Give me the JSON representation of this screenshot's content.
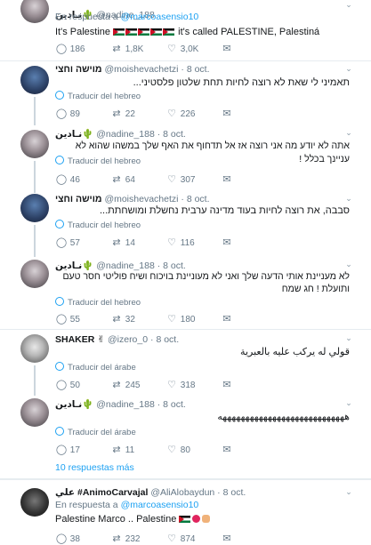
{
  "tweets": [
    {
      "name_display": "نـادين🌵",
      "handle": "@nadine_188",
      "date": "",
      "avatar": "female-photo",
      "reply_prefix": "En respuesta a",
      "reply_to": "@marcoasensio10",
      "text_before": "It's Palestine",
      "text_after": "it's called PALESTINE, Palestiná",
      "translate": "",
      "reply_count": "",
      "retweets": "1,8K",
      "likes": "3,0K",
      "replies": "186"
    },
    {
      "name_display": "מוישה וחצי",
      "handle": "@moishevachetzi",
      "date": "8 oct.",
      "text": "תאמיני לי שאת לא רוצה לחיות תחת שלטון פלסטיני...",
      "translate": "Traducir del hebreo",
      "replies": "89",
      "retweets": "22",
      "likes": "226"
    },
    {
      "name_display": "نـادين🌵",
      "handle": "@nadine_188",
      "date": "8 oct.",
      "text": "אתה לא יודע מה אני רוצה אז אל תדחוף את האף שלך במשהו שהוא לא עניינך בכלל !",
      "translate": "Traducir del hebreo",
      "replies": "46",
      "retweets": "64",
      "likes": "307"
    },
    {
      "name_display": "מוישה וחצי",
      "handle": "@moishevachetzi",
      "date": "8 oct.",
      "text": "סבבה, את רוצה לחיות בעוד מדינה ערבית נחשלת ומושחתת...",
      "translate": "Traducir del hebreo",
      "replies": "57",
      "retweets": "14",
      "likes": "116"
    },
    {
      "name_display": "نـادين🌵",
      "handle": "@nadine_188",
      "date": "8 oct.",
      "text": "לא מעניינת אותי הדעה שלך ואני לא מעוניינת בויכוח ושיח פוליטי חסר טעם ותועלת ! חג שמח",
      "translate": "Traducir del hebreo",
      "replies": "55",
      "retweets": "32",
      "likes": "180"
    },
    {
      "name_display": "SHAKER ✌",
      "handle": "@izero_0",
      "date": "8 oct.",
      "text": "قولي له يركب عليه بالعبرية",
      "translate": "Traducir del árabe",
      "replies": "50",
      "retweets": "245",
      "likes": "318"
    },
    {
      "name_display": "نـادين🌵",
      "handle": "@nadine_188",
      "date": "8 oct.",
      "text": "ههههههههههههههههههههههههههههه",
      "translate": "Traducir del árabe",
      "replies": "17",
      "retweets": "11",
      "likes": "80"
    },
    {
      "name_display": "علي #AnimoCarvajal",
      "handle": "@AliAlobaydun",
      "date": "8 oct.",
      "reply_prefix": "En respuesta a",
      "reply_to": "@marcoasensio10",
      "text": "Palestine Marco .. Palestine",
      "replies": "38",
      "retweets": "232",
      "likes": "874"
    }
  ],
  "more_replies": "10 respuestas más",
  "colors": {
    "link": "#1da1f2",
    "muted": "#657786",
    "separator": "#e6ecf0",
    "thread_line": "#ccd6dd"
  },
  "icons": {
    "reply": "comment-bubble-icon",
    "retweet": "retweet-arrows-icon",
    "like": "heart-icon",
    "dm": "envelope-icon",
    "more": "chevron-down-icon",
    "translate": "globe-icon"
  }
}
